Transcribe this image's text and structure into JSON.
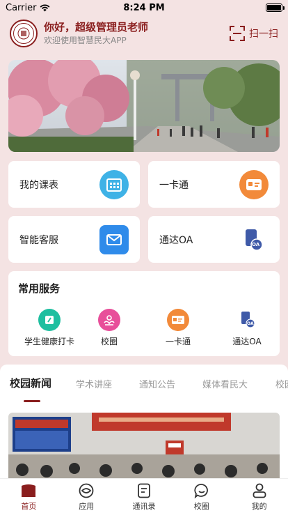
{
  "status": {
    "carrier": "Carrier",
    "time": "8:24 PM",
    "battery_level": 1.0
  },
  "header": {
    "greeting": "你好，超级管理员老师",
    "welcome": "欢迎使用智慧民大APP",
    "scan_label": "扫一扫"
  },
  "quick": {
    "schedule": "我的课表",
    "card": "一卡通",
    "support": "智能客服",
    "oa": "通达OA",
    "oa_badge": "OA"
  },
  "services": {
    "title": "常用服务",
    "items": [
      {
        "label": "学生健康打卡",
        "icon": "health-checkin-icon"
      },
      {
        "label": "校圈",
        "icon": "campus-circle-icon"
      },
      {
        "label": "一卡通",
        "icon": "campus-card-icon"
      },
      {
        "label": "通达OA",
        "icon": "oa-icon"
      }
    ],
    "oa_badge": "OA"
  },
  "news": {
    "tabs": [
      "校园新闻",
      "学术讲座",
      "通知公告",
      "媒体看民大",
      "校园"
    ],
    "active_tab": 0
  },
  "tabbar": {
    "items": [
      {
        "label": "首页",
        "icon": "home-icon"
      },
      {
        "label": "应用",
        "icon": "apps-icon"
      },
      {
        "label": "通讯录",
        "icon": "contacts-icon"
      },
      {
        "label": "校圈",
        "icon": "chat-icon"
      },
      {
        "label": "我的",
        "icon": "profile-icon"
      }
    ],
    "active": 0
  },
  "colors": {
    "accent": "#8a1e1e",
    "background": "#f4e3e3",
    "schedule_icon": "#3fb2e6",
    "card_icon": "#f28a3a",
    "support_icon": "#2f8bea",
    "oa_icon": "#3f5aa8",
    "health_icon": "#1fbfa0",
    "campus_icon": "#e84f9a"
  }
}
